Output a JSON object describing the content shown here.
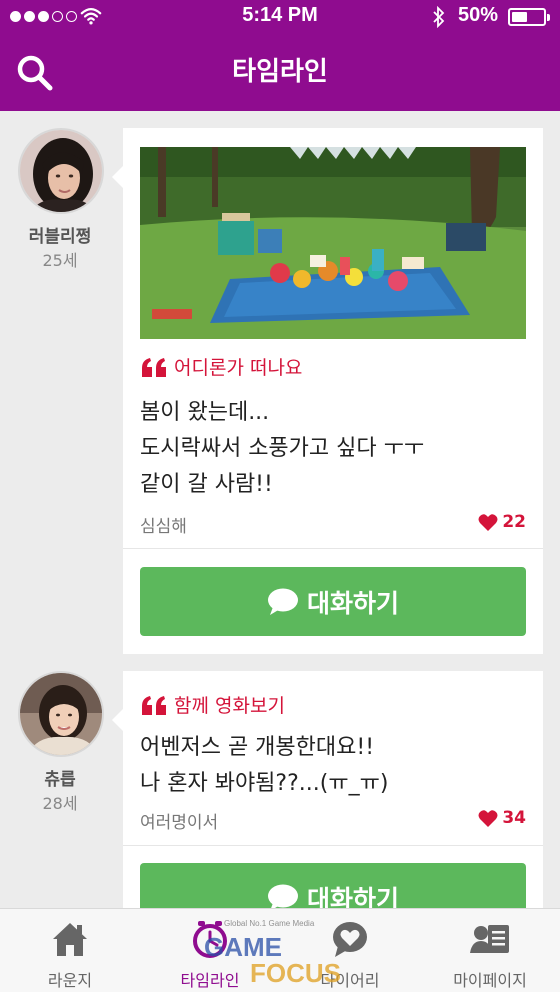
{
  "status": {
    "time": "5:14 PM",
    "battery": "50%",
    "battery_level": 0.5
  },
  "header": {
    "title": "타임라인"
  },
  "posts": [
    {
      "author": "러블리쩡",
      "age": "25세",
      "category": "어디론가 떠나요",
      "lines": [
        "봄이 왔는데...",
        "도시락싸서 소풍가고 싶다 ㅜㅜ",
        "같이 갈 사람!!"
      ],
      "location": "심심해",
      "likes": "22",
      "button": "대화하기"
    },
    {
      "author": "츄릅",
      "age": "28세",
      "category": "함께 영화보기",
      "lines": [
        "어벤저스 곧 개봉한대요!!",
        "나 혼자 봐야됨??...(ㅠ_ㅠ)"
      ],
      "location": "여러명이서",
      "likes": "34",
      "button": "대화하기"
    }
  ],
  "tabs": [
    {
      "label": "라운지",
      "icon": "home-icon"
    },
    {
      "label": "타임라인",
      "icon": "clock-icon",
      "active": true
    },
    {
      "label": "다이어리",
      "icon": "heart-chat-icon"
    },
    {
      "label": "마이페이지",
      "icon": "profile-card-icon"
    }
  ],
  "watermark": {
    "top": "Global No.1 Game Media",
    "brand_a": "GAME",
    "brand_b": "FOCUS"
  },
  "colors": {
    "brand": "#8f0c8f",
    "accent": "#d4143a",
    "button": "#5cb85c"
  }
}
